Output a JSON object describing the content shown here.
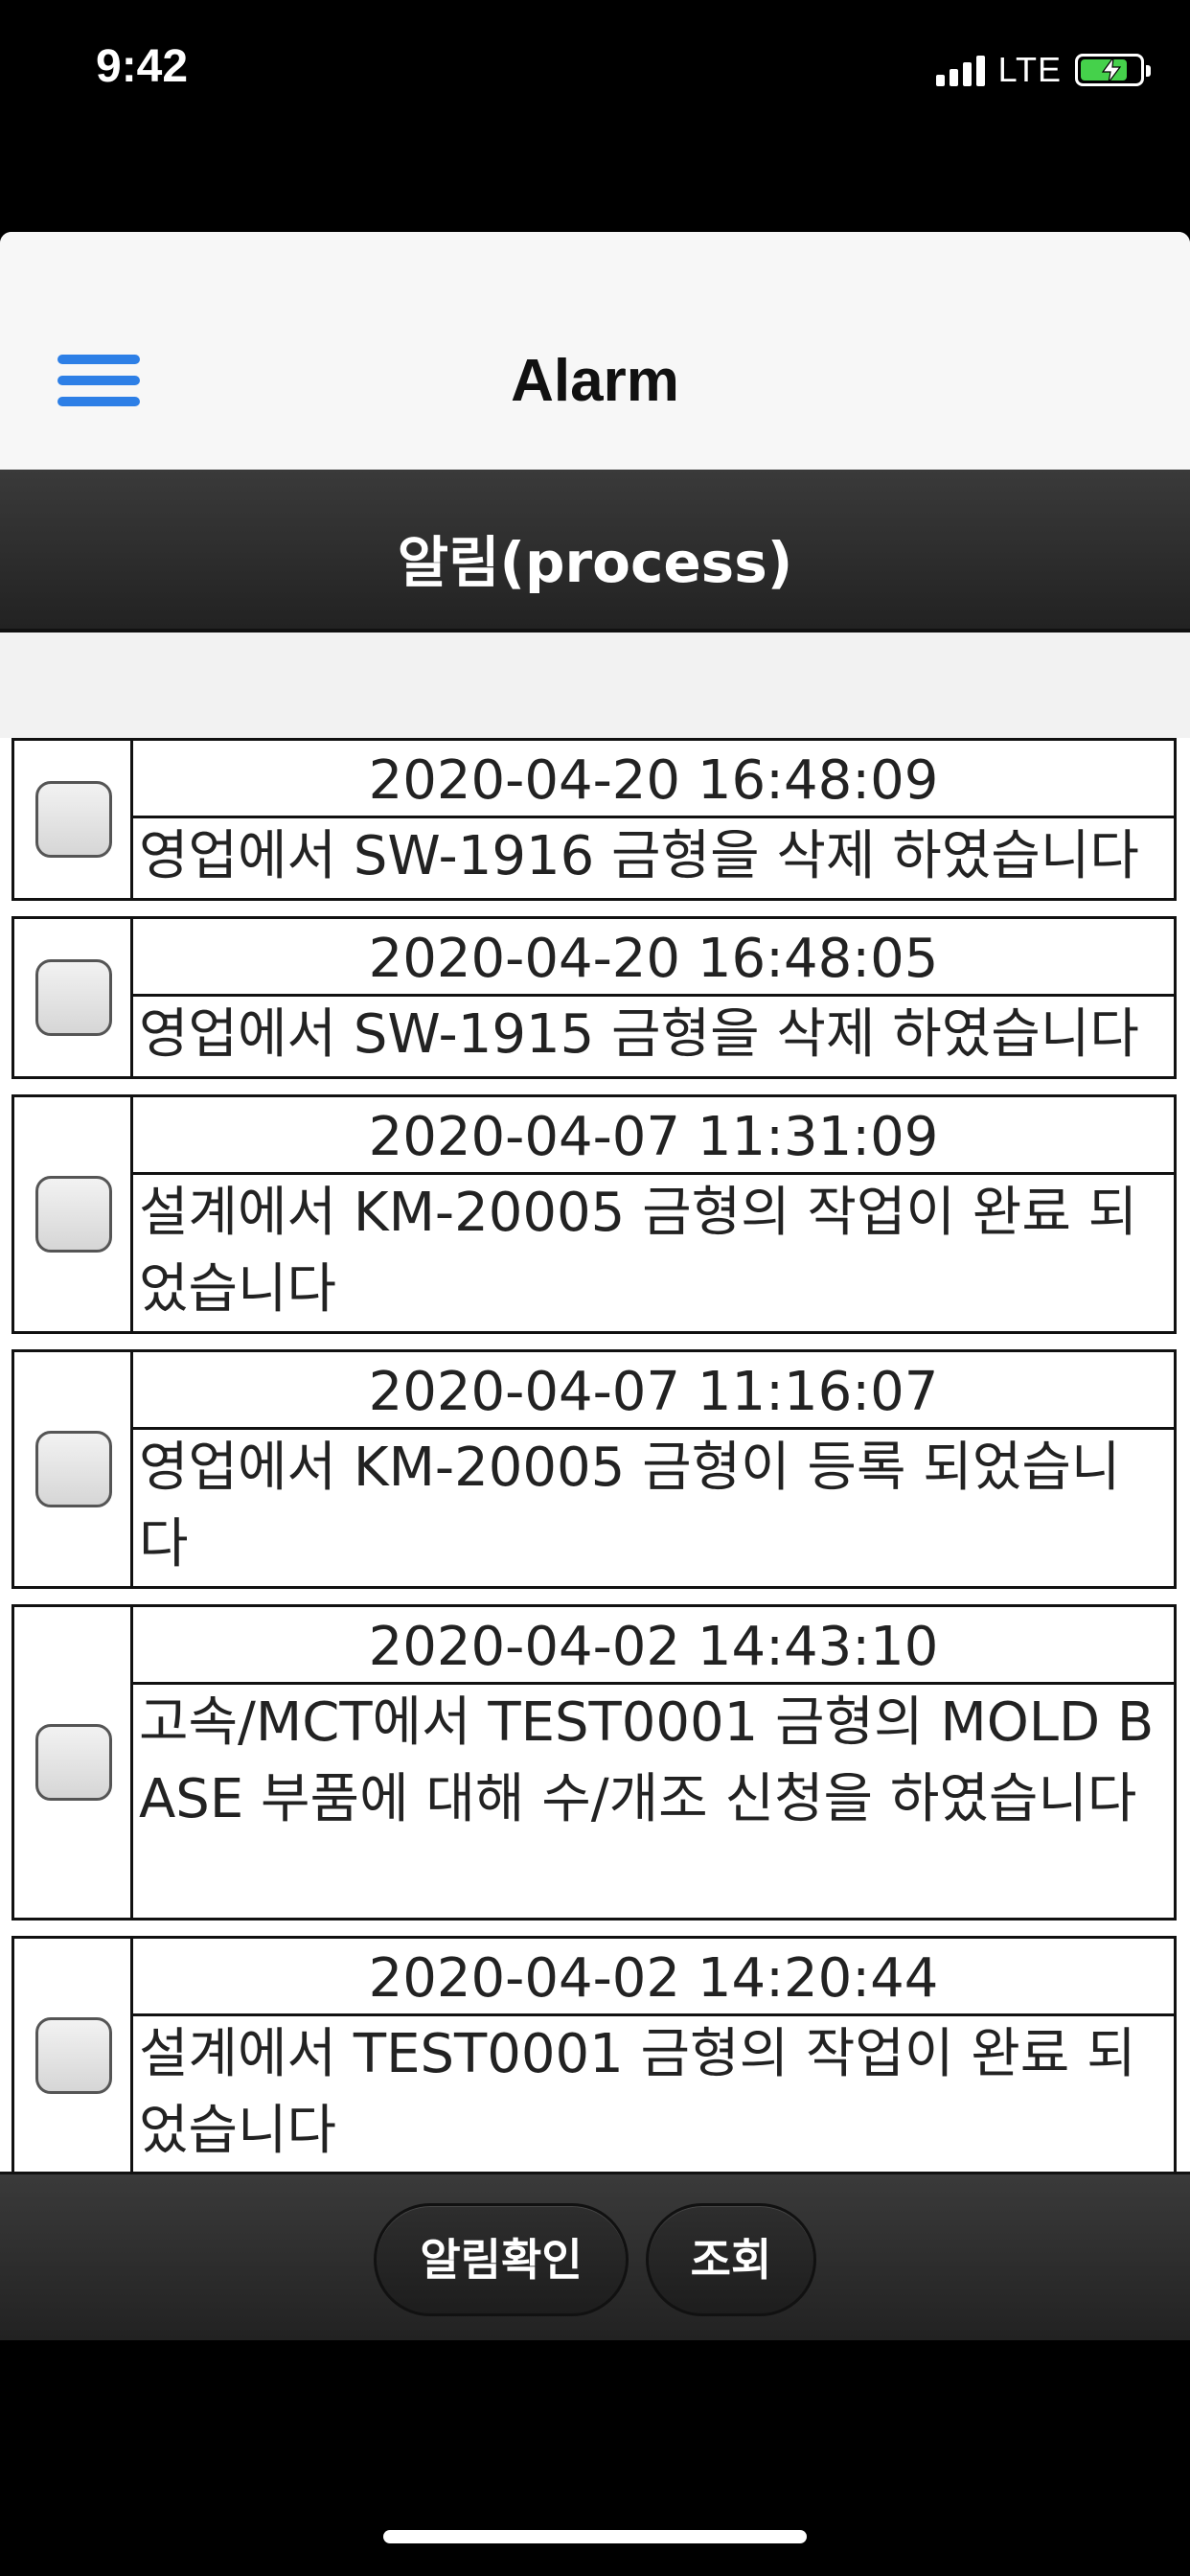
{
  "status_bar": {
    "time": "9:42",
    "network": "LTE",
    "battery_color": "#45d14b",
    "battery_level": 0.8
  },
  "nav": {
    "title": "Alarm",
    "menu_icon": "hamburger-menu-icon",
    "accent_color": "#2d7fe6"
  },
  "section": {
    "title": "알림(process)"
  },
  "alarms": [
    {
      "time": "2020-04-20 16:48:09",
      "message": "영업에서 SW-1916 금형을 삭제 하였습니다",
      "checked": false
    },
    {
      "time": "2020-04-20 16:48:05",
      "message": "영업에서 SW-1915 금형을 삭제 하였습니다",
      "checked": false
    },
    {
      "time": "2020-04-07 11:31:09",
      "message": "설계에서 KM-20005 금형의 작업이 완료 되었습니다",
      "checked": false
    },
    {
      "time": "2020-04-07 11:16:07",
      "message": "영업에서 KM-20005 금형이 등록 되었습니다",
      "checked": false
    },
    {
      "time": "2020-04-02 14:43:10",
      "message": "고속/MCT에서 TEST0001 금형의 MOLD BASE 부품에 대해 수/개조 신청을 하였습니다",
      "checked": false
    },
    {
      "time": "2020-04-02 14:20:44",
      "message": "설계에서 TEST0001 금형의 작업이 완료 되었습니다",
      "checked": false
    }
  ],
  "toolbar": {
    "confirm_label": "알림확인",
    "search_label": "조회"
  }
}
